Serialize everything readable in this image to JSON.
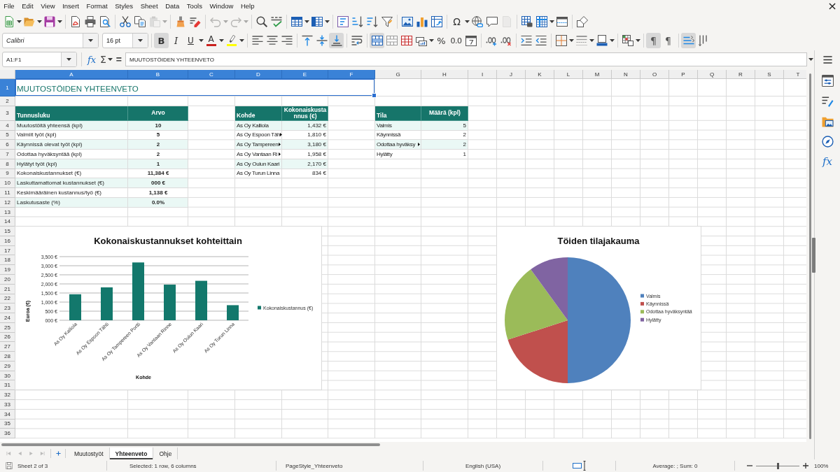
{
  "menu_bar": {
    "items": [
      "File",
      "Edit",
      "View",
      "Insert",
      "Format",
      "Styles",
      "Sheet",
      "Data",
      "Tools",
      "Window",
      "Help"
    ]
  },
  "standard_toolbar": {
    "groups": [
      [
        {
          "kind": "new",
          "disabled": false
        },
        {
          "kind": "open",
          "disabled": false
        },
        {
          "kind": "save",
          "disabled": false
        }
      ],
      [
        {
          "kind": "export_pdf",
          "disabled": false
        },
        {
          "kind": "print",
          "disabled": false
        },
        {
          "kind": "print_preview",
          "disabled": false
        }
      ],
      [
        {
          "kind": "cut",
          "disabled": false
        },
        {
          "kind": "copy",
          "disabled": false
        },
        {
          "kind": "paste",
          "disabled": true
        }
      ],
      [
        {
          "kind": "clone_formatting",
          "disabled": false
        },
        {
          "kind": "clear_formatting",
          "disabled": false
        }
      ],
      [
        {
          "kind": "undo",
          "disabled": true
        },
        {
          "kind": "redo",
          "disabled": true
        }
      ],
      [
        {
          "kind": "find_replace",
          "disabled": false
        },
        {
          "kind": "spelling",
          "disabled": false
        }
      ],
      [
        {
          "kind": "insert_rows",
          "disabled": false
        },
        {
          "kind": "insert_columns",
          "disabled": false
        }
      ],
      [
        {
          "kind": "sort",
          "disabled": false
        },
        {
          "kind": "sort_ascending",
          "disabled": false
        },
        {
          "kind": "sort_descending",
          "disabled": false
        },
        {
          "kind": "autofilter",
          "disabled": false
        }
      ],
      [
        {
          "kind": "image",
          "disabled": false
        },
        {
          "kind": "chart",
          "disabled": false
        },
        {
          "kind": "pivot_table",
          "disabled": false
        }
      ],
      [
        {
          "kind": "special_character",
          "glyph": "Ω",
          "disabled": false
        },
        {
          "kind": "hyperlink",
          "disabled": false
        },
        {
          "kind": "comment",
          "disabled": false
        },
        {
          "kind": "header_footer",
          "disabled": true
        }
      ],
      [
        {
          "kind": "print_area",
          "disabled": false
        },
        {
          "kind": "freeze",
          "disabled": false
        },
        {
          "kind": "split_window",
          "disabled": false
        }
      ],
      [
        {
          "kind": "shapes",
          "disabled": false
        }
      ]
    ]
  },
  "formatting_toolbar": {
    "font_name": "Calibri",
    "font_size": "16 pt",
    "groups": [
      [
        {
          "kind": "bold",
          "glyph": "B",
          "on": true
        },
        {
          "kind": "italic",
          "glyph": "I",
          "on": false
        },
        {
          "kind": "underline",
          "glyph": "U",
          "on": false
        },
        {
          "kind": "font_color",
          "glyph": "A",
          "color": "#c9211e",
          "on": false
        },
        {
          "kind": "highlight",
          "color": "#ffff00",
          "on": false
        }
      ],
      [
        {
          "kind": "align_left",
          "on": false
        },
        {
          "kind": "align_center",
          "on": false
        },
        {
          "kind": "align_right",
          "on": false
        }
      ],
      [
        {
          "kind": "align_top",
          "on": false
        },
        {
          "kind": "align_middle",
          "on": false
        },
        {
          "kind": "align_bottom",
          "on": true
        }
      ],
      [
        {
          "kind": "wrap_text",
          "on": false
        }
      ],
      [
        {
          "kind": "merge_center",
          "on": true
        },
        {
          "kind": "merge",
          "on": false
        },
        {
          "kind": "unmerge",
          "on": false
        },
        {
          "kind": "currency",
          "on": false
        },
        {
          "kind": "percent",
          "glyph": "%",
          "on": false
        },
        {
          "kind": "number",
          "glyph": "0.0",
          "on": false
        },
        {
          "kind": "date",
          "on": false
        }
      ],
      [
        {
          "kind": "add_decimal",
          "on": false
        },
        {
          "kind": "delete_decimal",
          "on": false
        }
      ],
      [
        {
          "kind": "indent",
          "on": false
        },
        {
          "kind": "outdent",
          "on": false
        }
      ],
      [
        {
          "kind": "borders",
          "on": false
        },
        {
          "kind": "border_style",
          "on": false
        },
        {
          "kind": "border_color",
          "on": false
        }
      ],
      [
        {
          "kind": "conditional",
          "on": false
        }
      ],
      [
        {
          "kind": "left_to_right",
          "glyph": "¶",
          "on": true
        },
        {
          "kind": "right_to_left",
          "glyph": "¶",
          "on": false
        }
      ],
      [
        {
          "kind": "horizontal_text",
          "on": true
        },
        {
          "kind": "vertical_text",
          "on": false
        }
      ]
    ]
  },
  "formula_bar": {
    "name_box": "A1:F1",
    "function_wizard": "fx",
    "sum": "Σ",
    "equals": "=",
    "content": "MUUTOSTÖIDEN YHTEENVETO"
  },
  "sheet": {
    "columns": [
      {
        "label": "A",
        "selected": true
      },
      {
        "label": "B",
        "selected": true
      },
      {
        "label": "C",
        "selected": true
      },
      {
        "label": "D",
        "selected": true
      },
      {
        "label": "E",
        "selected": true
      },
      {
        "label": "F",
        "selected": true
      },
      {
        "label": "G",
        "selected": false
      },
      {
        "label": "H",
        "selected": false
      },
      {
        "label": "I",
        "selected": false
      },
      {
        "label": "J",
        "selected": false
      },
      {
        "label": "K",
        "selected": false
      },
      {
        "label": "L",
        "selected": false
      },
      {
        "label": "M",
        "selected": false
      },
      {
        "label": "N",
        "selected": false
      },
      {
        "label": "O",
        "selected": false
      },
      {
        "label": "P",
        "selected": false
      },
      {
        "label": "Q",
        "selected": false
      },
      {
        "label": "R",
        "selected": false
      },
      {
        "label": "S",
        "selected": false
      },
      {
        "label": "T",
        "selected": false
      }
    ],
    "rows": [
      {
        "label": "1",
        "selected": true
      },
      {
        "label": "2",
        "selected": false
      },
      {
        "label": "3",
        "selected": false
      },
      {
        "label": "4",
        "selected": false
      },
      {
        "label": "5",
        "selected": false
      },
      {
        "label": "6",
        "selected": false
      },
      {
        "label": "7",
        "selected": false
      },
      {
        "label": "8",
        "selected": false
      },
      {
        "label": "9",
        "selected": false
      },
      {
        "label": "10",
        "selected": false
      },
      {
        "label": "11",
        "selected": false
      },
      {
        "label": "12",
        "selected": false
      },
      {
        "label": "13",
        "selected": false
      },
      {
        "label": "14",
        "selected": false
      },
      {
        "label": "15",
        "selected": false
      },
      {
        "label": "16",
        "selected": false
      },
      {
        "label": "17",
        "selected": false
      },
      {
        "label": "18",
        "selected": false
      },
      {
        "label": "19",
        "selected": false
      },
      {
        "label": "20",
        "selected": false
      },
      {
        "label": "21",
        "selected": false
      },
      {
        "label": "22",
        "selected": false
      },
      {
        "label": "23",
        "selected": false
      },
      {
        "label": "24",
        "selected": false
      },
      {
        "label": "25",
        "selected": false
      },
      {
        "label": "26",
        "selected": false
      },
      {
        "label": "27",
        "selected": false
      },
      {
        "label": "28",
        "selected": false
      },
      {
        "label": "29",
        "selected": false
      },
      {
        "label": "30",
        "selected": false
      },
      {
        "label": "31",
        "selected": false
      },
      {
        "label": "32",
        "selected": false
      },
      {
        "label": "33",
        "selected": false
      },
      {
        "label": "34",
        "selected": false
      },
      {
        "label": "35",
        "selected": false
      },
      {
        "label": "36",
        "selected": false
      }
    ],
    "title": {
      "text": "MUUTOSTÖIDEN YHTEENVETO",
      "selected": true
    },
    "tables": [
      {
        "kind": "metrics",
        "headers": [
          "Tunnusluku",
          "Arvo"
        ],
        "rows": [
          {
            "cells": [
              "Muutostöitä yhteensä (kpl)",
              "10"
            ]
          },
          {
            "cells": [
              "Valmiit työt (kpl)",
              "5"
            ]
          },
          {
            "cells": [
              "Käynnissä olevat työt (kpl)",
              "2"
            ]
          },
          {
            "cells": [
              "Odottaa hyväksyntää (kpl)",
              "2"
            ]
          },
          {
            "cells": [
              "Hylätyt työt (kpl)",
              "1"
            ]
          },
          {
            "cells": [
              "Kokonaiskustannukset (€)",
              "11,384 €"
            ]
          },
          {
            "cells": [
              "Laskuttamattomat kustannukset (€)",
              "000 €"
            ]
          },
          {
            "cells": [
              "Keskimääräinen kustannus/työ (€)",
              "1,138 €"
            ]
          },
          {
            "cells": [
              "Laskutusaste (%)",
              "0.0%"
            ]
          }
        ]
      },
      {
        "kind": "list",
        "headers": [
          "Kohde",
          "Kokonaiskustannus (€)"
        ],
        "rows": [
          {
            "cells": [
              "As Oy Kalliola",
              "1,432 €"
            ],
            "clipped": false
          },
          {
            "cells": [
              "As Oy Espoon Täh",
              "1,810 €"
            ],
            "clipped": true
          },
          {
            "cells": [
              "As Oy Tampereen",
              "3,180 €"
            ],
            "clipped": true
          },
          {
            "cells": [
              "As Oy Vantaan Ri",
              "1,958 €"
            ],
            "clipped": true
          },
          {
            "cells": [
              "As Oy Oulun Kaari",
              "2,170 €"
            ],
            "clipped": false
          },
          {
            "cells": [
              "As Oy Turun Linna",
              "834 €"
            ],
            "clipped": false
          }
        ]
      },
      {
        "kind": "list",
        "headers": [
          "Tila",
          "Määrä (kpl)"
        ],
        "rows": [
          {
            "cells": [
              "Valmis",
              "5"
            ],
            "clipped": false
          },
          {
            "cells": [
              "Käynnissä",
              "2"
            ],
            "clipped": false
          },
          {
            "cells": [
              "Odottaa hyväksy",
              "2"
            ],
            "clipped": true
          },
          {
            "cells": [
              "Hylätty",
              "1"
            ],
            "clipped": false
          }
        ]
      }
    ],
    "charts": [
      {
        "chart_data": {
          "type": "bar",
          "title": "Kokonaiskustannukset kohteittain",
          "xlabel": "Kohde",
          "ylabel": "Euroa (€)",
          "categories": [
            "As Oy Kalliola",
            "As Oy Espoon Tähti",
            "As Oy Tampereen Portti",
            "As Oy Vantaan Rinne",
            "As Oy Oulun Kaari",
            "As Oy Turun Linna"
          ],
          "series": [
            {
              "name": "Kokonaiskustannus (€)",
              "color": "#13786c",
              "values": [
                1430,
                1810,
                3180,
                1960,
                2170,
                830
              ]
            }
          ],
          "ylim": [
            0,
            3500
          ],
          "yticks": [
            {
              "value": 0,
              "label": "000 €"
            },
            {
              "value": 500,
              "label": "500 €"
            },
            {
              "value": 1000,
              "label": "1,000 €"
            },
            {
              "value": 1500,
              "label": "1,500 €"
            },
            {
              "value": 2000,
              "label": "2,000 €"
            },
            {
              "value": 2500,
              "label": "2,500 €"
            },
            {
              "value": 3000,
              "label": "3,000 €"
            },
            {
              "value": 3500,
              "label": "3,500 €"
            }
          ],
          "grid": true,
          "legend": "right"
        }
      },
      {
        "chart_data": {
          "type": "pie",
          "title": "Töiden tilajakauma",
          "categories": [
            "Valmis",
            "Käynnissä",
            "Odottaa hyväksyntää",
            "Hylätty"
          ],
          "values": [
            50,
            20,
            20,
            10
          ],
          "colors": [
            "#4f81bd",
            "#c0504d",
            "#9bbb59",
            "#8064a2"
          ],
          "legend": "right"
        }
      }
    ]
  },
  "sheet_tabs": {
    "navigation_disabled": true,
    "tabs": [
      {
        "label": "Muutostyöt",
        "selected": false
      },
      {
        "label": "Yhteenveto",
        "selected": true
      },
      {
        "label": "Ohje",
        "selected": false
      }
    ]
  },
  "sidebar": {
    "tabs": [
      {
        "kind": "properties"
      },
      {
        "kind": "styles"
      },
      {
        "kind": "gallery"
      },
      {
        "kind": "navigator"
      },
      {
        "kind": "functions",
        "glyph": "fx"
      }
    ]
  },
  "status_bar": {
    "sheet": "Sheet 2 of 3",
    "selection": "Selected: 1 row, 6 columns",
    "page_style": "PageStyle_Yhteenveto",
    "language": "English (USA)",
    "summary": "Average: ; Sum: 0",
    "zoom": {
      "level": 0.5,
      "reading": "100%"
    }
  }
}
